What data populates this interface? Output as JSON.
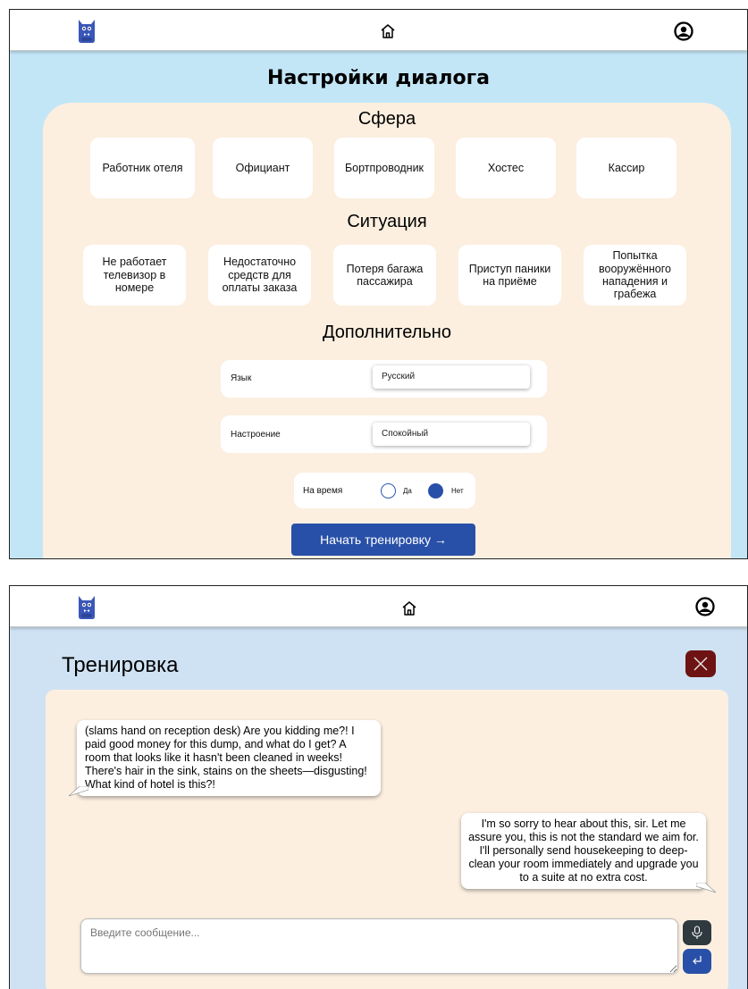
{
  "colors": {
    "settings_background": "#c3e6f7",
    "training_background": "#cfe2f3",
    "panel": "#fcefe0",
    "primary_button": "#2950a8",
    "close_button": "#6e1313",
    "mic_button": "#2f3940"
  },
  "icons": {
    "logo": "mascot-icon",
    "home": "home-icon",
    "profile": "user-icon",
    "close": "close-icon",
    "mic": "mic-icon",
    "send": "send-icon"
  },
  "settings": {
    "title": "Настройки диалога",
    "sphere": {
      "heading": "Сфера",
      "options": [
        "Работник отеля",
        "Официант",
        "Бортпроводник",
        "Хостес",
        "Кассир"
      ]
    },
    "situation": {
      "heading": "Ситуация",
      "options": [
        "Не работает телевизор в номере",
        "Недостаточно средств для оплаты заказа",
        "Потеря багажа пассажира",
        "Приступ паники на приёме",
        "Попытка вооружённого нападения и грабежа"
      ]
    },
    "additional": {
      "heading": "Дополнительно",
      "language": {
        "label": "Язык",
        "value": "Русский"
      },
      "mood": {
        "label": "Настроение",
        "value": "Спокойный"
      },
      "timed": {
        "label": "На время",
        "yes_label": "Да",
        "no_label": "Нет",
        "selected": "Нет"
      }
    },
    "start_button": "Начать тренировку →"
  },
  "training": {
    "title": "Тренировка",
    "messages": [
      {
        "from": "bot",
        "text": "(slams hand on reception desk) Are you kidding me?! I paid good money for this dump, and what do I get? A room that looks like it hasn't been cleaned in weeks! There's hair in the sink, stains on the sheets—disgusting! What kind of hotel is this?!"
      },
      {
        "from": "user",
        "text": "I'm so sorry to hear about this, sir. Let me assure you, this is not the standard we aim for. I'll personally send housekeeping to deep-clean your room immediately and upgrade you to a suite at no extra cost."
      }
    ],
    "input": {
      "placeholder": "Введите сообщение...",
      "value": ""
    }
  }
}
